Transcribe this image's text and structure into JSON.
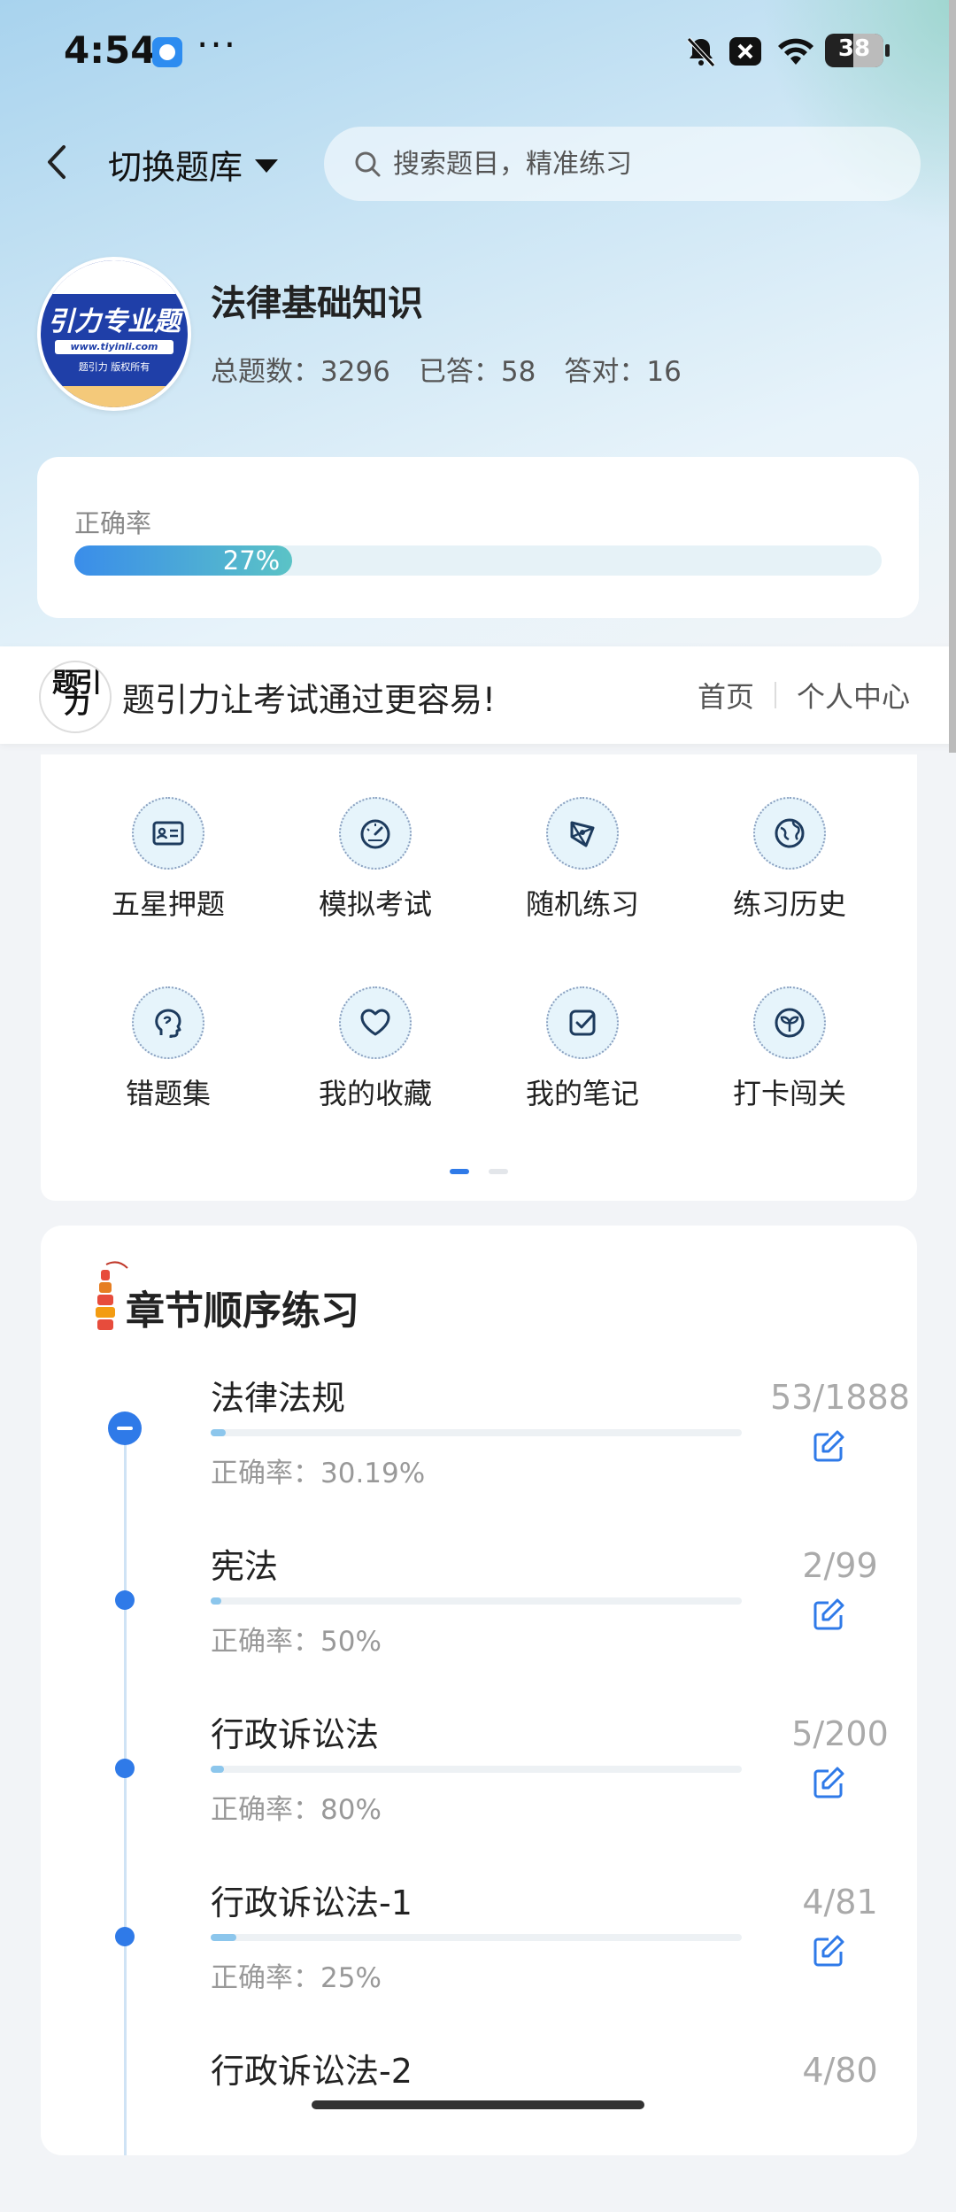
{
  "status": {
    "time": "4:54",
    "dots": "···",
    "battery": "38"
  },
  "nav": {
    "switch_label": "切换题库",
    "search_placeholder": "搜索题目，精准练习"
  },
  "subject": {
    "logo_text": "引力专业题",
    "logo_site": "www.tiyinli.com",
    "logo_copy": "题引力 版权所有",
    "name": "法律基础知识",
    "total_label": "总题数：3296",
    "answered_label": "已答：58",
    "correct_label": "答对：16"
  },
  "accuracy": {
    "label": "正确率",
    "value_text": "27%",
    "value": 0.27
  },
  "banner": {
    "logo_text": "题引力",
    "slogan": "题引力让考试通过更容易!",
    "home": "首页",
    "user_center": "个人中心"
  },
  "functions": [
    {
      "label": "五星押题",
      "icon": "id-card-icon"
    },
    {
      "label": "模拟考试",
      "icon": "speedometer-icon"
    },
    {
      "label": "随机练习",
      "icon": "shuffle-icon"
    },
    {
      "label": "练习历史",
      "icon": "globe-history-icon"
    },
    {
      "label": "错题集",
      "icon": "brain-head-icon"
    },
    {
      "label": "我的收藏",
      "icon": "heart-icon"
    },
    {
      "label": "我的笔记",
      "icon": "note-check-icon"
    },
    {
      "label": "打卡闯关",
      "icon": "sprout-icon"
    }
  ],
  "pager": {
    "pages": 2,
    "active": 0
  },
  "chapters": {
    "title": "章节顺序练习",
    "items": [
      {
        "name": "法律法规",
        "rate": "正确率：30.19%",
        "count": "53/1888",
        "progress": 0.028,
        "active": true
      },
      {
        "name": "宪法",
        "rate": "正确率：50%",
        "count": "2/99",
        "progress": 0.02,
        "active": false
      },
      {
        "name": "行政诉讼法",
        "rate": "正确率：80%",
        "count": "5/200",
        "progress": 0.025,
        "active": false
      },
      {
        "name": "行政诉讼法-1",
        "rate": "正确率：25%",
        "count": "4/81",
        "progress": 0.049,
        "active": false
      },
      {
        "name": "行政诉讼法-2",
        "rate": "",
        "count": "4/80",
        "progress": 0.05,
        "active": false
      }
    ]
  },
  "colors": {
    "accent": "#2f7ae8",
    "teal": "#5bc3c6",
    "text": "#222222"
  }
}
